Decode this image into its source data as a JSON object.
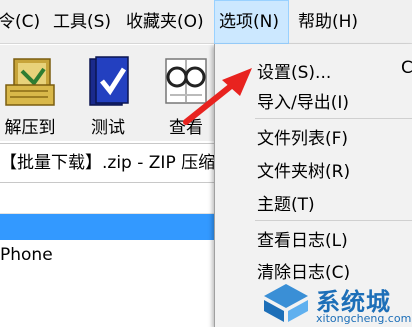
{
  "menubar": {
    "items": [
      "令(C)",
      "工具(S)",
      "收藏夹(O)",
      "选项(N)",
      "帮助(H)"
    ]
  },
  "toolbar": {
    "extract_label": "解压到",
    "test_label": "测试",
    "view_label": "查看"
  },
  "pathbar": {
    "text": "【批量下载】.zip - ZIP 压缩文"
  },
  "list": {
    "phone_text": "Phone"
  },
  "dropdown": {
    "items": [
      "设置(S)...",
      "导入/导出(I)",
      "文件列表(F)",
      "文件夹树(R)",
      "主题(T)",
      "查看日志(L)",
      "清除日志(C)"
    ],
    "settings_shortcut": "Ct"
  },
  "watermark": {
    "brand": "系统城",
    "url": "xitongcheng.com"
  },
  "colors": {
    "menu_active_bg": "#cce8ff",
    "selection": "#3399ff",
    "arrow": "#e8231f"
  }
}
